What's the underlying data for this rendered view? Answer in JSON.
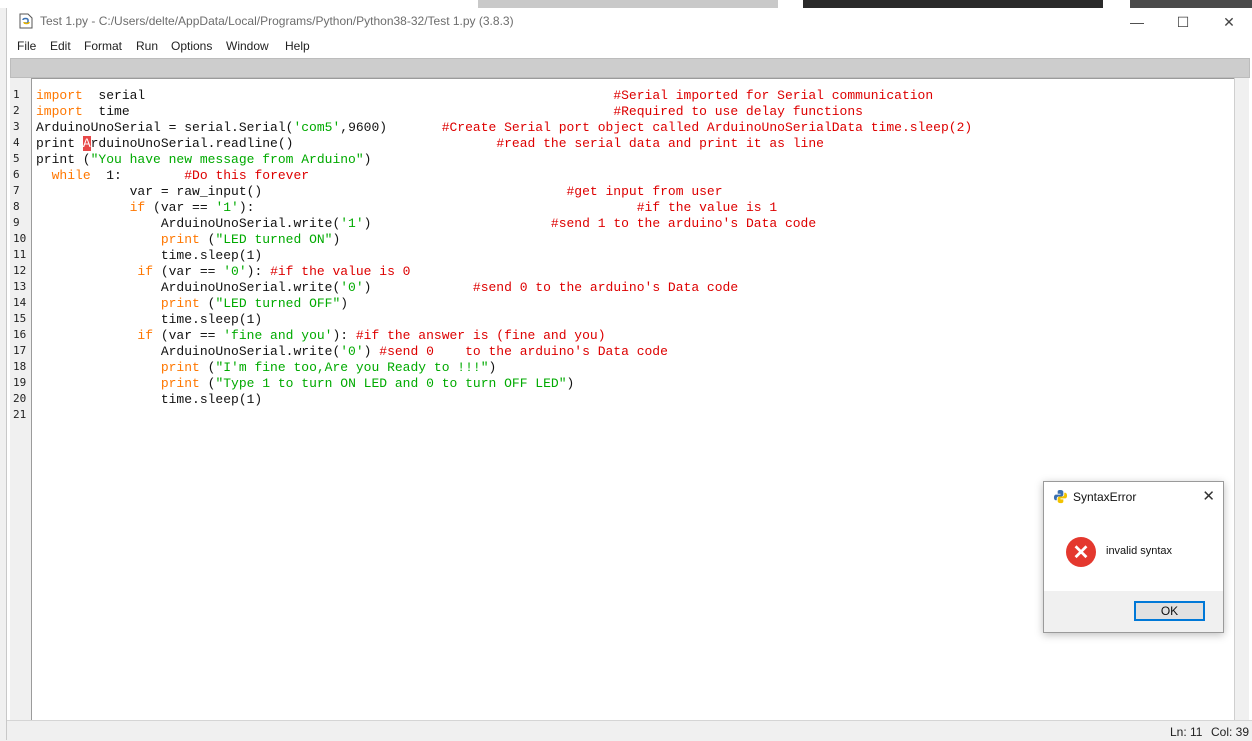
{
  "window": {
    "title": "Test 1.py - C:/Users/delte/AppData/Local/Programs/Python/Python38-32/Test 1.py (3.8.3)",
    "minimize_glyph": "—",
    "maximize_glyph": "☐",
    "close_glyph": "✕"
  },
  "menu": [
    "File",
    "Edit",
    "Format",
    "Run",
    "Options",
    "Window",
    "Help"
  ],
  "lines": [
    {
      "n": "1",
      "segs": [
        [
          "kw",
          "import"
        ],
        [
          "",
          "  serial"
        ],
        [
          "",
          "                                                            "
        ],
        [
          "cm",
          "#Serial imported for Serial communication"
        ]
      ]
    },
    {
      "n": "2",
      "segs": [
        [
          "kw",
          "import"
        ],
        [
          "",
          "  time"
        ],
        [
          "",
          "                                                              "
        ],
        [
          "cm",
          "#Required to use delay functions"
        ]
      ]
    },
    {
      "n": "3",
      "segs": [
        [
          "",
          "ArduinoUnoSerial = serial.Serial("
        ],
        [
          "str",
          "'com5'"
        ],
        [
          "",
          ",9600)       "
        ],
        [
          "cm",
          "#Create Serial port object called ArduinoUnoSerialData time.sleep(2)"
        ]
      ]
    },
    {
      "n": "4",
      "segs": [
        [
          "",
          "print "
        ],
        [
          "cur",
          "A"
        ],
        [
          "",
          "rduinoUnoSerial.readline()"
        ],
        [
          "",
          "                          "
        ],
        [
          "cm",
          "#read the serial data and print it as line"
        ]
      ]
    },
    {
      "n": "5",
      "segs": [
        [
          "",
          "print ("
        ],
        [
          "str",
          "\"You have new message from Arduino\""
        ],
        [
          "",
          ")"
        ]
      ]
    },
    {
      "n": "6",
      "segs": [
        [
          "",
          "  "
        ],
        [
          "kw",
          "while"
        ],
        [
          "",
          "  1:        "
        ],
        [
          "cm",
          "#Do this forever"
        ]
      ]
    },
    {
      "n": "7",
      "segs": [
        [
          "",
          "            var = raw_input()"
        ],
        [
          "",
          "                                       "
        ],
        [
          "cm",
          "#get input from user"
        ]
      ]
    },
    {
      "n": "8",
      "segs": [
        [
          "",
          "            "
        ],
        [
          "kw",
          "if"
        ],
        [
          "",
          " (var == "
        ],
        [
          "str",
          "'1'"
        ],
        [
          "",
          "):"
        ],
        [
          "",
          "                                                 "
        ],
        [
          "cm",
          "#if the value is 1"
        ]
      ]
    },
    {
      "n": "9",
      "segs": [
        [
          "",
          "                ArduinoUnoSerial.write("
        ],
        [
          "str",
          "'1'"
        ],
        [
          "",
          ")"
        ],
        [
          "",
          "                       "
        ],
        [
          "cm",
          "#send 1 to the arduino's Data code"
        ]
      ]
    },
    {
      "n": "10",
      "segs": [
        [
          "",
          "                "
        ],
        [
          "kw",
          "print"
        ],
        [
          "",
          " ("
        ],
        [
          "str",
          "\"LED turned ON\""
        ],
        [
          "",
          ")"
        ]
      ]
    },
    {
      "n": "11",
      "segs": [
        [
          "",
          "                time.sleep(1)"
        ]
      ]
    },
    {
      "n": "12",
      "segs": [
        [
          "",
          "             "
        ],
        [
          "kw",
          "if"
        ],
        [
          "",
          " (var == "
        ],
        [
          "str",
          "'0'"
        ],
        [
          "",
          "): "
        ],
        [
          "cm",
          "#if the value is 0"
        ]
      ]
    },
    {
      "n": "13",
      "segs": [
        [
          "",
          "                ArduinoUnoSerial.write("
        ],
        [
          "str",
          "'0'"
        ],
        [
          "",
          ")"
        ],
        [
          "",
          "             "
        ],
        [
          "cm",
          "#send 0 to the arduino's Data code"
        ]
      ]
    },
    {
      "n": "14",
      "segs": [
        [
          "",
          "                "
        ],
        [
          "kw",
          "print"
        ],
        [
          "",
          " ("
        ],
        [
          "str",
          "\"LED turned OFF\""
        ],
        [
          "",
          ")"
        ]
      ]
    },
    {
      "n": "15",
      "segs": [
        [
          "",
          "                time.sleep(1)"
        ]
      ]
    },
    {
      "n": "16",
      "segs": [
        [
          "",
          "             "
        ],
        [
          "kw",
          "if"
        ],
        [
          "",
          " (var == "
        ],
        [
          "str",
          "'fine and you'"
        ],
        [
          "",
          "): "
        ],
        [
          "cm",
          "#if the answer is (fine and you)"
        ]
      ]
    },
    {
      "n": "17",
      "segs": [
        [
          "",
          "                ArduinoUnoSerial.write("
        ],
        [
          "str",
          "'0'"
        ],
        [
          "",
          ") "
        ],
        [
          "cm",
          "#send 0    to the arduino's Data code"
        ]
      ]
    },
    {
      "n": "18",
      "segs": [
        [
          "",
          "                "
        ],
        [
          "kw",
          "print"
        ],
        [
          "",
          " ("
        ],
        [
          "str",
          "\"I'm fine too,Are you Ready to !!!\""
        ],
        [
          "",
          ")"
        ]
      ]
    },
    {
      "n": "19",
      "segs": [
        [
          "",
          "                "
        ],
        [
          "kw",
          "print"
        ],
        [
          "",
          " ("
        ],
        [
          "str",
          "\"Type 1 to turn ON LED and 0 to turn OFF LED\""
        ],
        [
          "",
          ")"
        ]
      ]
    },
    {
      "n": "20",
      "segs": [
        [
          "",
          "                time.sleep(1)"
        ]
      ]
    },
    {
      "n": "21",
      "segs": []
    }
  ],
  "status": {
    "line": "Ln: 11",
    "col": "Col: 39"
  },
  "dialog": {
    "title": "SyntaxError",
    "message": "invalid syntax",
    "ok_label": "OK",
    "close_glyph": "✕",
    "error_glyph": "✕"
  },
  "colors": {
    "keyword": "#ff7700",
    "string": "#00aa00",
    "comment": "#dd0000",
    "error": "#e4382e"
  }
}
